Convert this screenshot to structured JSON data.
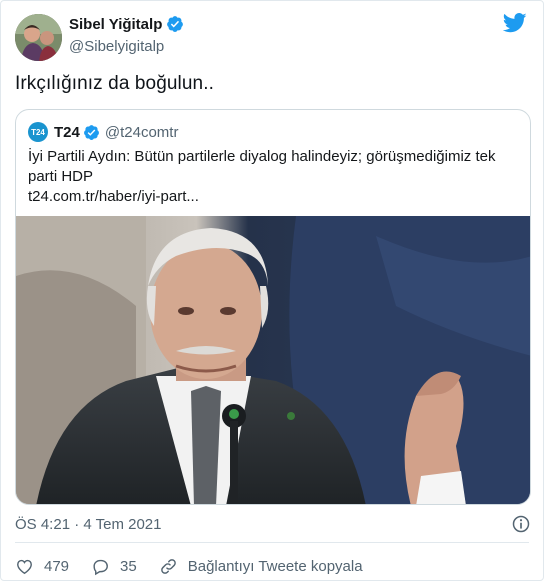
{
  "author": {
    "name": "Sibel Yiğitalp",
    "handle": "@Sibelyigitalp"
  },
  "tweet_text": "Irkçılığınız da boğulun..",
  "quoted": {
    "logo_text": "T24",
    "name": "T24",
    "handle": "@t24comtr",
    "text": "İyi Partili Aydın: Bütün partilerle diyalog halindeyiz; görüşmediğimiz tek parti HDP",
    "link": "t24.com.tr/haber/iyi-part..."
  },
  "timestamp": "ÖS 4:21 · 4 Tem 2021",
  "actions": {
    "likes": "479",
    "replies": "35",
    "copy_link_label": "Bağlantıyı Tweete kopyala"
  },
  "colors": {
    "brand_blue": "#1d9bf0",
    "like_red": "#e0245e",
    "muted": "#536471"
  },
  "icons": [
    "verified-badge-icon",
    "twitter-bird-icon",
    "info-icon",
    "heart-icon",
    "reply-icon",
    "link-icon"
  ]
}
